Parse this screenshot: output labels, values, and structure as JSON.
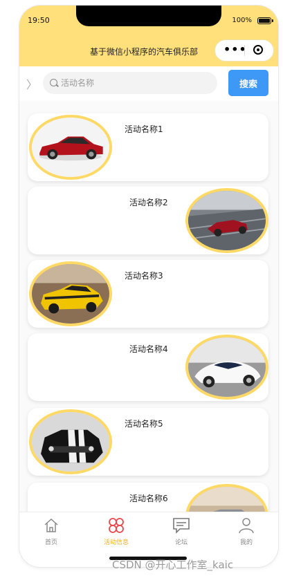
{
  "status": {
    "time": "19:50",
    "battery": "100%"
  },
  "navbar": {
    "title": "基于微信小程序的汽车俱乐部"
  },
  "search": {
    "placeholder": "活动名称",
    "value": "",
    "button_label": "搜索"
  },
  "activities": [
    {
      "title": "活动名称1",
      "image": "red-sedan"
    },
    {
      "title": "活动名称2",
      "image": "red-convertible"
    },
    {
      "title": "活动名称3",
      "image": "yellow-muscle-car"
    },
    {
      "title": "活动名称4",
      "image": "white-concept-car"
    },
    {
      "title": "活动名称5",
      "image": "black-muscle-car"
    },
    {
      "title": "活动名称6",
      "image": "silver-car"
    }
  ],
  "tabbar": {
    "items": [
      {
        "label": "首页",
        "icon": "home-icon",
        "active": false
      },
      {
        "label": "活动信息",
        "icon": "clover-icon",
        "active": true
      },
      {
        "label": "论坛",
        "icon": "chat-icon",
        "active": false
      },
      {
        "label": "我的",
        "icon": "user-icon",
        "active": false
      }
    ]
  },
  "watermark": "CSDN @开心工作室_kaic",
  "colors": {
    "theme_yellow": "#ffe07a",
    "card_ring": "#ffd966",
    "search_blue": "#3e98f5",
    "active_tab": "#f0b400"
  }
}
